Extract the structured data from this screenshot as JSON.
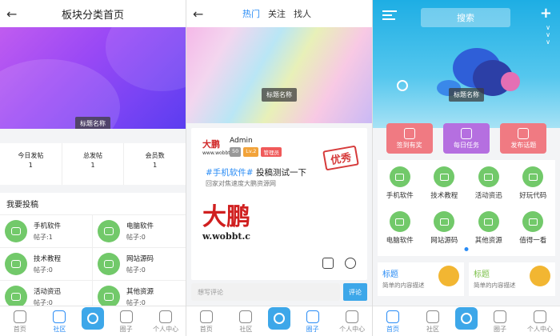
{
  "phone1": {
    "title": "板块分类首页",
    "banner_label": "标题名称",
    "stats": [
      {
        "label": "今日发帖",
        "value": "1"
      },
      {
        "label": "总发帖",
        "value": "1"
      },
      {
        "label": "会员数",
        "value": "1"
      }
    ],
    "section_title": "我要投稿",
    "boards": [
      {
        "name": "手机软件",
        "count": "帖子:1"
      },
      {
        "name": "电脑软件",
        "count": "帖子:0"
      },
      {
        "name": "技术教程",
        "count": "帖子:0"
      },
      {
        "name": "网站源码",
        "count": "帖子:0"
      },
      {
        "name": "活动资迅",
        "count": "帖子:0"
      },
      {
        "name": "其他资源",
        "count": "帖子:0"
      }
    ],
    "nav": [
      "首页",
      "社区",
      "圈子",
      "个人中心"
    ]
  },
  "phone2": {
    "tabs": [
      "热门",
      "关注",
      "找人"
    ],
    "banner_label": "标题名称",
    "post": {
      "logo": "大鹏",
      "logo_sub": "www.wobbt",
      "username": "Admin",
      "badges": [
        "50",
        "Lv.2",
        "管理员"
      ],
      "stamp": "优秀",
      "tag": "#手机软件#",
      "title": " 投稿测试一下",
      "subtitle": "回家对焦速度大鹏资源网",
      "big_text": "大鹏",
      "url_text": "w.wobbt.c"
    },
    "comment_placeholder": "想写评论",
    "comment_button": "评论",
    "nav": [
      "首页",
      "社区",
      "圈子",
      "个人中心"
    ]
  },
  "phone3": {
    "search": "搜索",
    "plus": "+",
    "banner_label": "标题名称",
    "actions": [
      {
        "label": "签到有奖",
        "color": "#f07a82"
      },
      {
        "label": "每日任务",
        "color": "#b56fe0"
      },
      {
        "label": "发布话题",
        "color": "#f07a82"
      }
    ],
    "categories": [
      "手机软件",
      "技术教程",
      "活动资迅",
      "好玩代码",
      "电脑软件",
      "网站源码",
      "其他资源",
      "值得一看"
    ],
    "promos": [
      {
        "title": "标题",
        "desc": "简单的内容描述",
        "color": "#2a8cf5"
      },
      {
        "title": "标题",
        "desc": "简单的内容描述",
        "color": "#7cc04a"
      }
    ],
    "nav": [
      "首页",
      "社区",
      "圈子",
      "个人中心"
    ]
  },
  "colors": {
    "accent": "#2a8cf5",
    "green_icon": "#72c96a",
    "center_nav": "#3da7e9"
  }
}
